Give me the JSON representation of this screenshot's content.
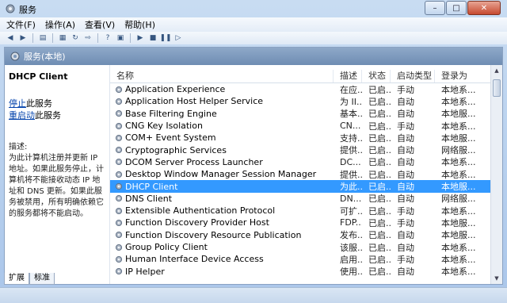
{
  "window": {
    "title": "服务",
    "minimize": "–",
    "maximize": "□",
    "close": "✕"
  },
  "menu": [
    "文件(F)",
    "操作(A)",
    "查看(V)",
    "帮助(H)"
  ],
  "panel": {
    "title": "服务(本地)"
  },
  "left": {
    "service_title": "DHCP Client",
    "stop_link": "停止",
    "stop_suffix": "此服务",
    "restart_link": "重启动",
    "restart_suffix": "此服务",
    "desc_label": "描述:",
    "desc_text": "为此计算机注册并更新 IP 地址。如果此服务停止，计算机将不能接收动态 IP 地址和 DNS 更新。如果此服务被禁用，所有明确依赖它的服务都将不能启动。"
  },
  "columns": {
    "name": "名称",
    "desc": "描述",
    "status": "状态",
    "type": "启动类型",
    "logon": "登录为"
  },
  "rows": [
    {
      "name": "Application Experience",
      "desc": "在应...",
      "status": "已启...",
      "type": "手动",
      "logon": "本地系..."
    },
    {
      "name": "Application Host Helper Service",
      "desc": "为 II...",
      "status": "已启...",
      "type": "自动",
      "logon": "本地系..."
    },
    {
      "name": "Base Filtering Engine",
      "desc": "基本...",
      "status": "已启...",
      "type": "自动",
      "logon": "本地服..."
    },
    {
      "name": "CNG Key Isolation",
      "desc": "CN...",
      "status": "已启...",
      "type": "手动",
      "logon": "本地系..."
    },
    {
      "name": "COM+ Event System",
      "desc": "支持...",
      "status": "已启...",
      "type": "自动",
      "logon": "本地服..."
    },
    {
      "name": "Cryptographic Services",
      "desc": "提供...",
      "status": "已启...",
      "type": "自动",
      "logon": "网络服..."
    },
    {
      "name": "DCOM Server Process Launcher",
      "desc": "DC...",
      "status": "已启...",
      "type": "自动",
      "logon": "本地系..."
    },
    {
      "name": "Desktop Window Manager Session Manager",
      "desc": "提供...",
      "status": "已启...",
      "type": "自动",
      "logon": "本地系..."
    },
    {
      "name": "DHCP Client",
      "desc": "为此...",
      "status": "已启...",
      "type": "自动",
      "logon": "本地服...",
      "selected": true
    },
    {
      "name": "DNS Client",
      "desc": "DN...",
      "status": "已启...",
      "type": "自动",
      "logon": "网络服..."
    },
    {
      "name": "Extensible Authentication Protocol",
      "desc": "可扩...",
      "status": "已启...",
      "type": "手动",
      "logon": "本地系..."
    },
    {
      "name": "Function Discovery Provider Host",
      "desc": "FDP...",
      "status": "已启...",
      "type": "手动",
      "logon": "本地服..."
    },
    {
      "name": "Function Discovery Resource Publication",
      "desc": "发布...",
      "status": "已启...",
      "type": "自动",
      "logon": "本地服..."
    },
    {
      "name": "Group Policy Client",
      "desc": "该服...",
      "status": "已启...",
      "type": "自动",
      "logon": "本地系..."
    },
    {
      "name": "Human Interface Device Access",
      "desc": "启用...",
      "status": "已启...",
      "type": "手动",
      "logon": "本地系..."
    },
    {
      "name": "IP Helper",
      "desc": "使用...",
      "status": "已启...",
      "type": "自动",
      "logon": "本地系..."
    }
  ],
  "tabs": [
    "扩展",
    "标准"
  ],
  "icons": {
    "title": "gear-icon",
    "toolbar": [
      "back-icon",
      "forward-icon",
      "show-tree-icon",
      "properties-icon",
      "refresh-icon",
      "export-icon",
      "help-icon",
      "console-icon",
      "start-icon",
      "stop-icon",
      "pause-icon",
      "restart-icon"
    ],
    "service": "gear-icon"
  },
  "colors": {
    "selection": "#3399ff",
    "link": "#0645ad",
    "panel_header": "#7b97bb"
  }
}
